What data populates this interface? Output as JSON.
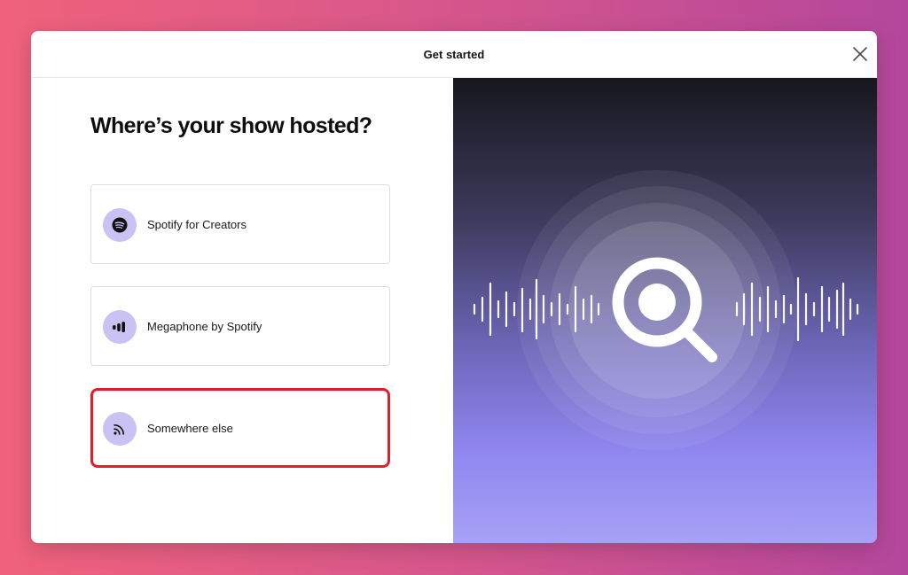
{
  "modal": {
    "title": "Get started",
    "close_icon": "close-icon"
  },
  "question": {
    "heading": "Where’s your show hosted?"
  },
  "options": [
    {
      "label": "Spotify for Creators",
      "icon": "spotify-logo-icon",
      "selected": false
    },
    {
      "label": "Megaphone by Spotify",
      "icon": "megaphone-logo-icon",
      "selected": false
    },
    {
      "label": "Somewhere else",
      "icon": "rss-feed-icon",
      "selected": true
    }
  ],
  "illustration": {
    "icon": "magnifying-glass-icon",
    "decor": "sound-wave-icon"
  },
  "colors": {
    "icon_bg": "#c9c2f3",
    "selected_border": "#e21d2c",
    "illustration_top": "#17171d",
    "illustration_bottom": "#a7a1f6"
  }
}
